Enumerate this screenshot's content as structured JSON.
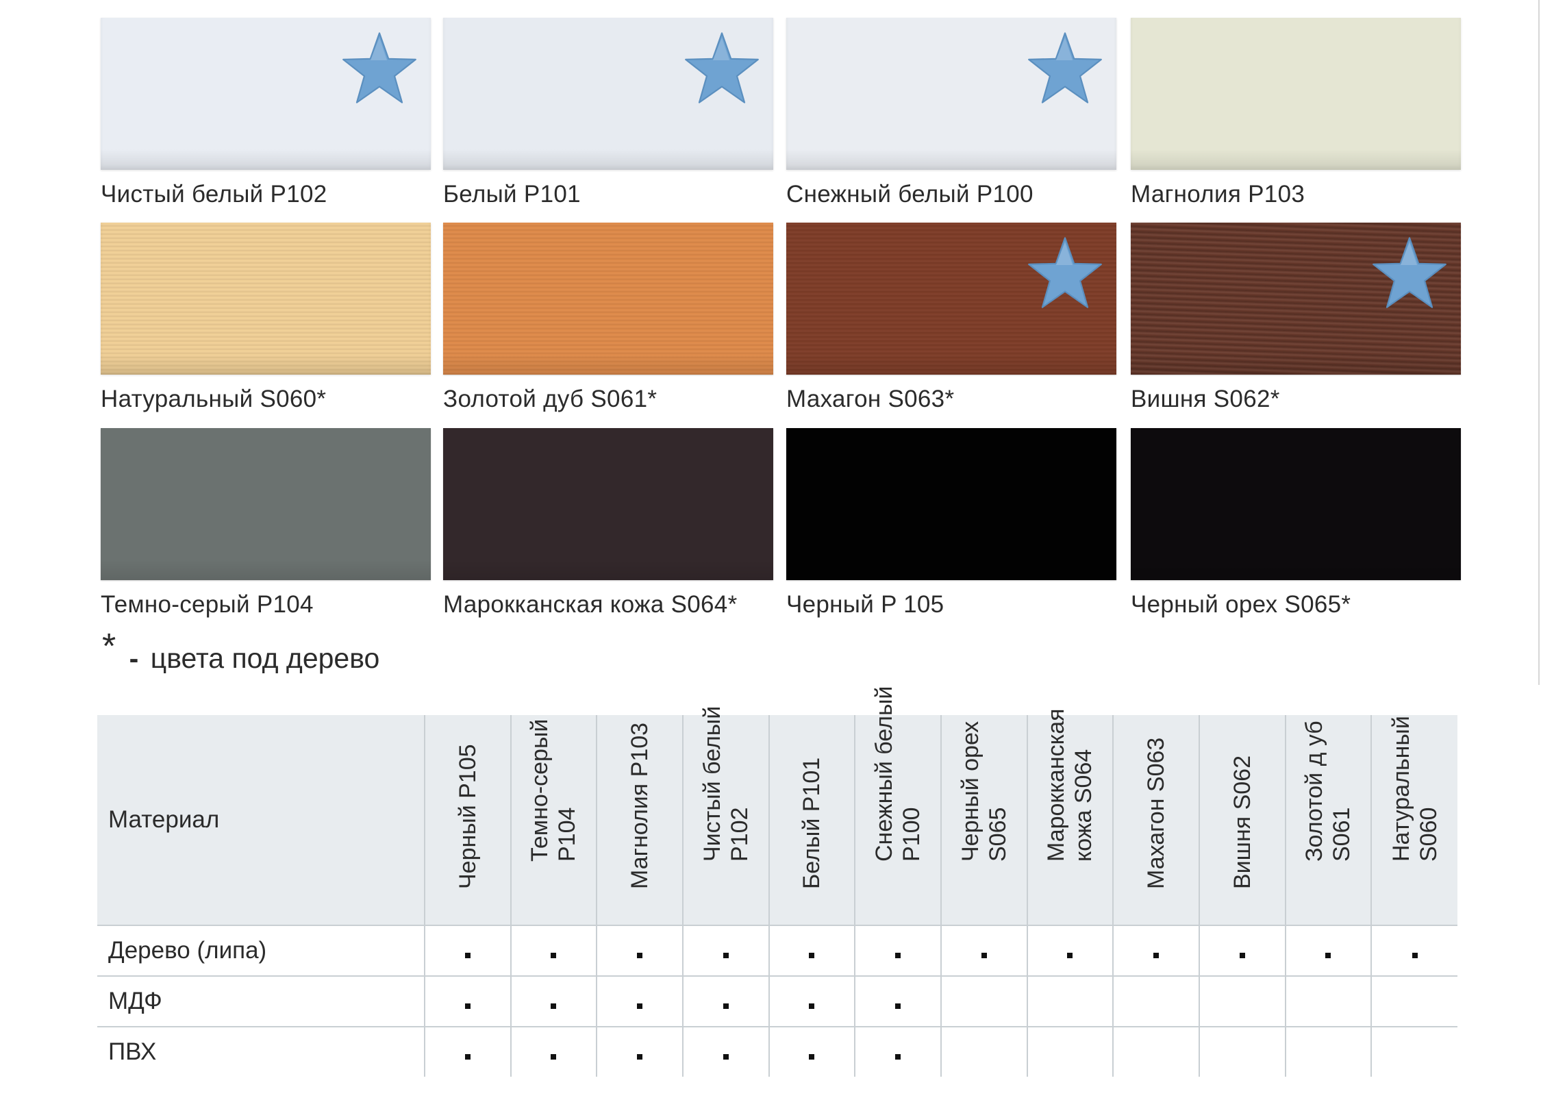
{
  "swatches": [
    {
      "label": "Чистый белый P102",
      "color": "#e9edf3",
      "starred": true,
      "wood": false,
      "light": true
    },
    {
      "label": "Белый P101",
      "color": "#e7ebf1",
      "starred": true,
      "wood": false,
      "light": true
    },
    {
      "label": "Снежный белый P100",
      "color": "#eaedf2",
      "starred": true,
      "wood": false,
      "light": true
    },
    {
      "label": "Магнолия P103",
      "color": "#e5e6d3",
      "starred": false,
      "wood": false,
      "light": true
    },
    {
      "label": "Натуральный S060*",
      "color": "#f0cf96",
      "starred": false,
      "wood": true,
      "light": true
    },
    {
      "label": "Золотой дуб S061*",
      "color": "#de8a4a",
      "starred": false,
      "wood": true,
      "light": false
    },
    {
      "label": "Махагон S063*",
      "color": "#7e3d28",
      "starred": true,
      "wood": true,
      "light": false
    },
    {
      "label": "Вишня S062*",
      "color": "#6a3a2c",
      "starred": true,
      "wood": true,
      "light": false,
      "darkgrain": true
    },
    {
      "label": "Темно-серый P104",
      "color": "#6b7270",
      "starred": false,
      "wood": false,
      "light": false
    },
    {
      "label": "Марокканская кожа S064*",
      "color": "#33282b",
      "starred": false,
      "wood": false,
      "light": false
    },
    {
      "label": "Черный P 105",
      "color": "#020202",
      "starred": false,
      "wood": false,
      "light": false
    },
    {
      "label": "Черный орех S065*",
      "color": "#0d0b0d",
      "starred": false,
      "wood": false,
      "light": false
    }
  ],
  "star_color": "#6fa3d2",
  "footnote": {
    "asterisk": "*",
    "dash": "-",
    "text": "цвета под дерево"
  },
  "table": {
    "header_first": "Материал",
    "columns": [
      "Черный P105",
      "Темно-серый P104",
      "Магнолия P103",
      "Чистый белый P102",
      "Белый P101",
      "Снежный белый P100",
      "Черный орех S065",
      "Марокканская кожа S064",
      "Махагон S063",
      "Вишня S062",
      "Золотой д уб S061",
      "Натуральный S060"
    ],
    "rows": [
      {
        "material": "Дерево (липа)",
        "marks": [
          true,
          true,
          true,
          true,
          true,
          true,
          true,
          true,
          true,
          true,
          true,
          true
        ]
      },
      {
        "material": "МДФ",
        "marks": [
          true,
          true,
          true,
          true,
          true,
          true,
          false,
          false,
          false,
          false,
          false,
          false
        ]
      },
      {
        "material": "ПВХ",
        "marks": [
          true,
          true,
          true,
          true,
          true,
          true,
          false,
          false,
          false,
          false,
          false,
          false
        ]
      }
    ]
  }
}
